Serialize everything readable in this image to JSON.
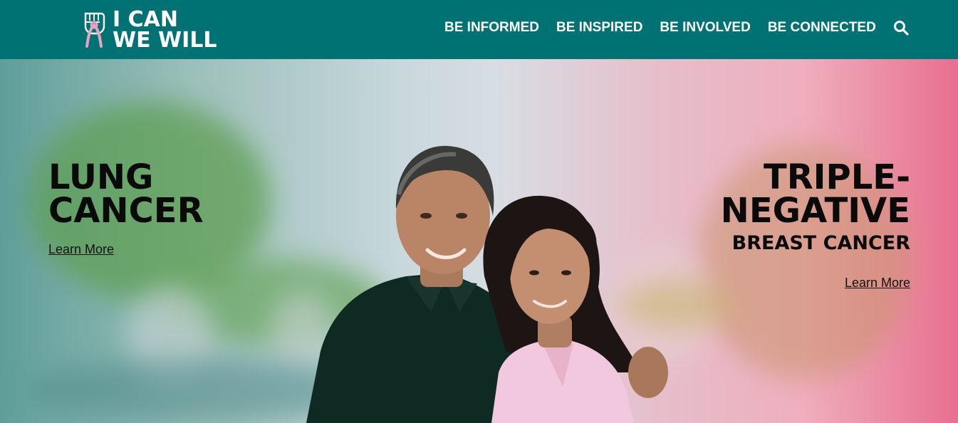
{
  "brand": {
    "line1": "I CAN",
    "line2": "WE WILL"
  },
  "nav": {
    "items": [
      "BE INFORMED",
      "BE INSPIRED",
      "BE INVOLVED",
      "BE CONNECTED"
    ],
    "search_icon": "search-icon"
  },
  "hero": {
    "left": {
      "title_line1": "LUNG",
      "title_line2": "CANCER",
      "link": "Learn More"
    },
    "right": {
      "title_line1": "TRIPLE-",
      "title_line2": "NEGATIVE",
      "subtitle": "BREAST CANCER",
      "link": "Learn More"
    }
  },
  "colors": {
    "header": "#007274",
    "text_dark": "#0a0a0a",
    "ribbon_pink": "#e9a3c0",
    "accent_pink": "#e96f8e"
  }
}
